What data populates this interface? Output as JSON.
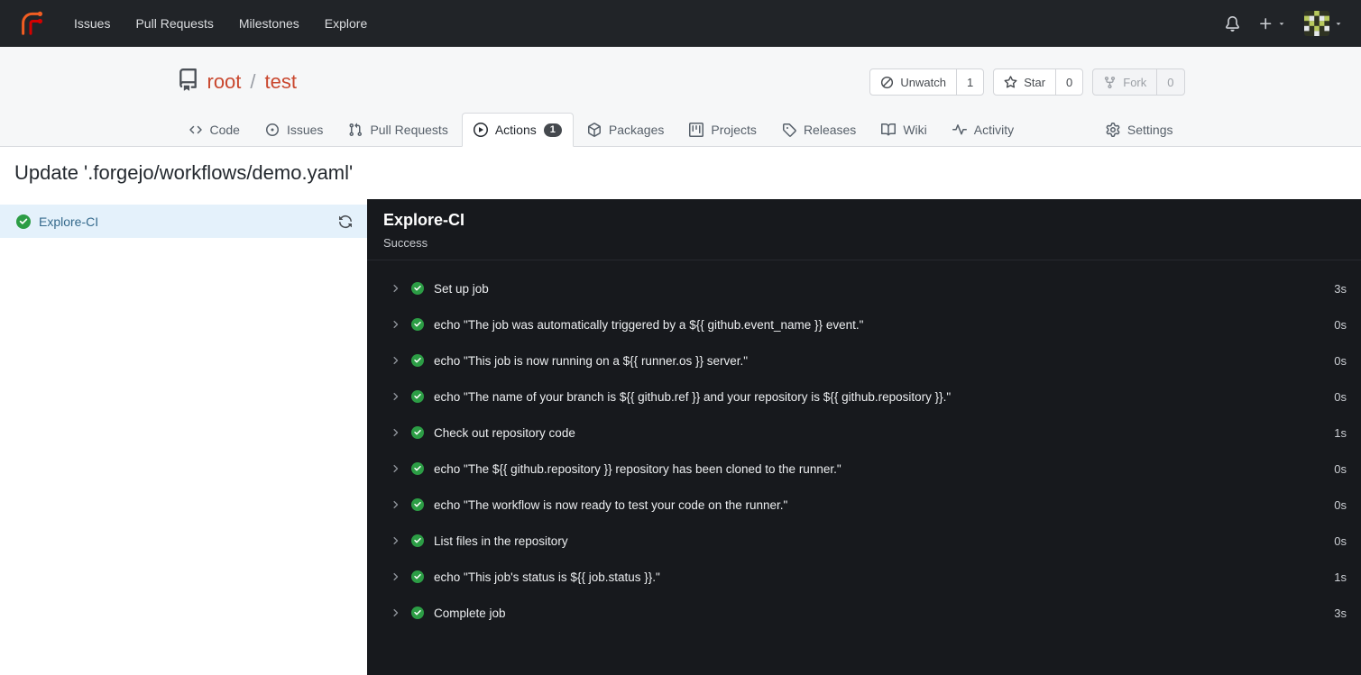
{
  "colors": {
    "primary": "#c9472e",
    "success_green": "#2c9d45",
    "navbar_bg": "#212428",
    "log_bg": "#17191d",
    "active_job_bg": "#e4f1fb"
  },
  "navbar": {
    "items": [
      {
        "label": "Issues"
      },
      {
        "label": "Pull Requests"
      },
      {
        "label": "Milestones"
      },
      {
        "label": "Explore"
      }
    ]
  },
  "repo": {
    "owner": "root",
    "separator": "/",
    "name": "test",
    "actions": [
      {
        "label": "Unwatch",
        "count": "1"
      },
      {
        "label": "Star",
        "count": "0"
      },
      {
        "label": "Fork",
        "count": "0"
      }
    ]
  },
  "tabs": [
    {
      "label": "Code"
    },
    {
      "label": "Issues"
    },
    {
      "label": "Pull Requests"
    },
    {
      "label": "Actions",
      "badge": "1"
    },
    {
      "label": "Packages"
    },
    {
      "label": "Projects"
    },
    {
      "label": "Releases"
    },
    {
      "label": "Wiki"
    },
    {
      "label": "Activity"
    },
    {
      "label": "Settings"
    }
  ],
  "page": {
    "title": "Update '.forgejo/workflows/demo.yaml'"
  },
  "sidebar": {
    "jobs": [
      {
        "name": "Explore-CI",
        "status": "success"
      }
    ]
  },
  "run": {
    "job_name": "Explore-CI",
    "status": "Success",
    "steps": [
      {
        "name": "Set up job",
        "duration": "3s"
      },
      {
        "name": "echo \"The job was automatically triggered by a ${{ github.event_name }} event.\"",
        "duration": "0s"
      },
      {
        "name": "echo \"This job is now running on a ${{ runner.os }} server.\"",
        "duration": "0s"
      },
      {
        "name": "echo \"The name of your branch is ${{ github.ref }} and your repository is ${{ github.repository }}.\"",
        "duration": "0s"
      },
      {
        "name": "Check out repository code",
        "duration": "1s"
      },
      {
        "name": "echo \"The ${{ github.repository }} repository has been cloned to the runner.\"",
        "duration": "0s"
      },
      {
        "name": "echo \"The workflow is now ready to test your code on the runner.\"",
        "duration": "0s"
      },
      {
        "name": "List files in the repository",
        "duration": "0s"
      },
      {
        "name": "echo \"This job's status is ${{ job.status }}.\"",
        "duration": "1s"
      },
      {
        "name": "Complete job",
        "duration": "3s"
      }
    ]
  }
}
